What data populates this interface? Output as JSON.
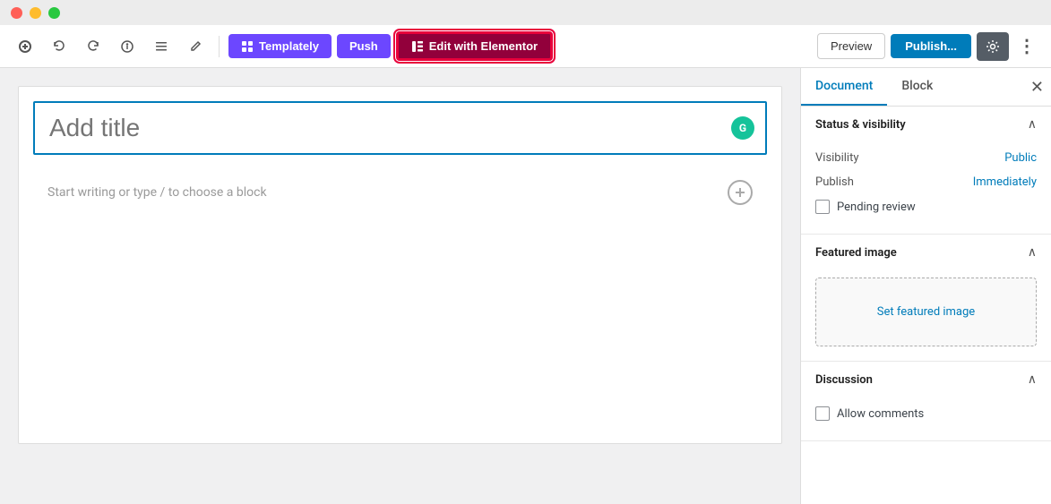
{
  "titleBar": {
    "buttons": [
      "close",
      "minimize",
      "maximize"
    ]
  },
  "toolbar": {
    "add_label": "+",
    "undo_label": "↩",
    "redo_label": "↪",
    "info_label": "ℹ",
    "list_label": "☰",
    "pen_label": "✏",
    "templately_label": "Templately",
    "push_label": "Push",
    "elementor_label": "Edit with Elementor",
    "preview_label": "Preview",
    "publish_label": "Publish...",
    "settings_label": "⚙",
    "more_label": "⋮"
  },
  "editor": {
    "title_placeholder": "Add title",
    "block_hint": "Start writing or type / to choose a block"
  },
  "sidebar": {
    "tabs": [
      {
        "label": "Document",
        "active": true
      },
      {
        "label": "Block",
        "active": false
      }
    ],
    "close_label": "✕",
    "sections": [
      {
        "id": "status-visibility",
        "title": "Status & visibility",
        "rows": [
          {
            "label": "Visibility",
            "value": "Public"
          },
          {
            "label": "Publish",
            "value": "Immediately"
          }
        ],
        "checkboxes": [
          {
            "label": "Pending review",
            "checked": false
          }
        ]
      },
      {
        "id": "featured-image",
        "title": "Featured image",
        "set_image_label": "Set featured image"
      },
      {
        "id": "discussion",
        "title": "Discussion",
        "checkboxes": [
          {
            "label": "Allow comments",
            "checked": false
          }
        ]
      }
    ]
  },
  "colors": {
    "accent": "#007cba",
    "elementor": "#92003b",
    "elementor_border": "#e8003b",
    "purple": "#6c47ff",
    "grammarly": "#15c39a"
  }
}
